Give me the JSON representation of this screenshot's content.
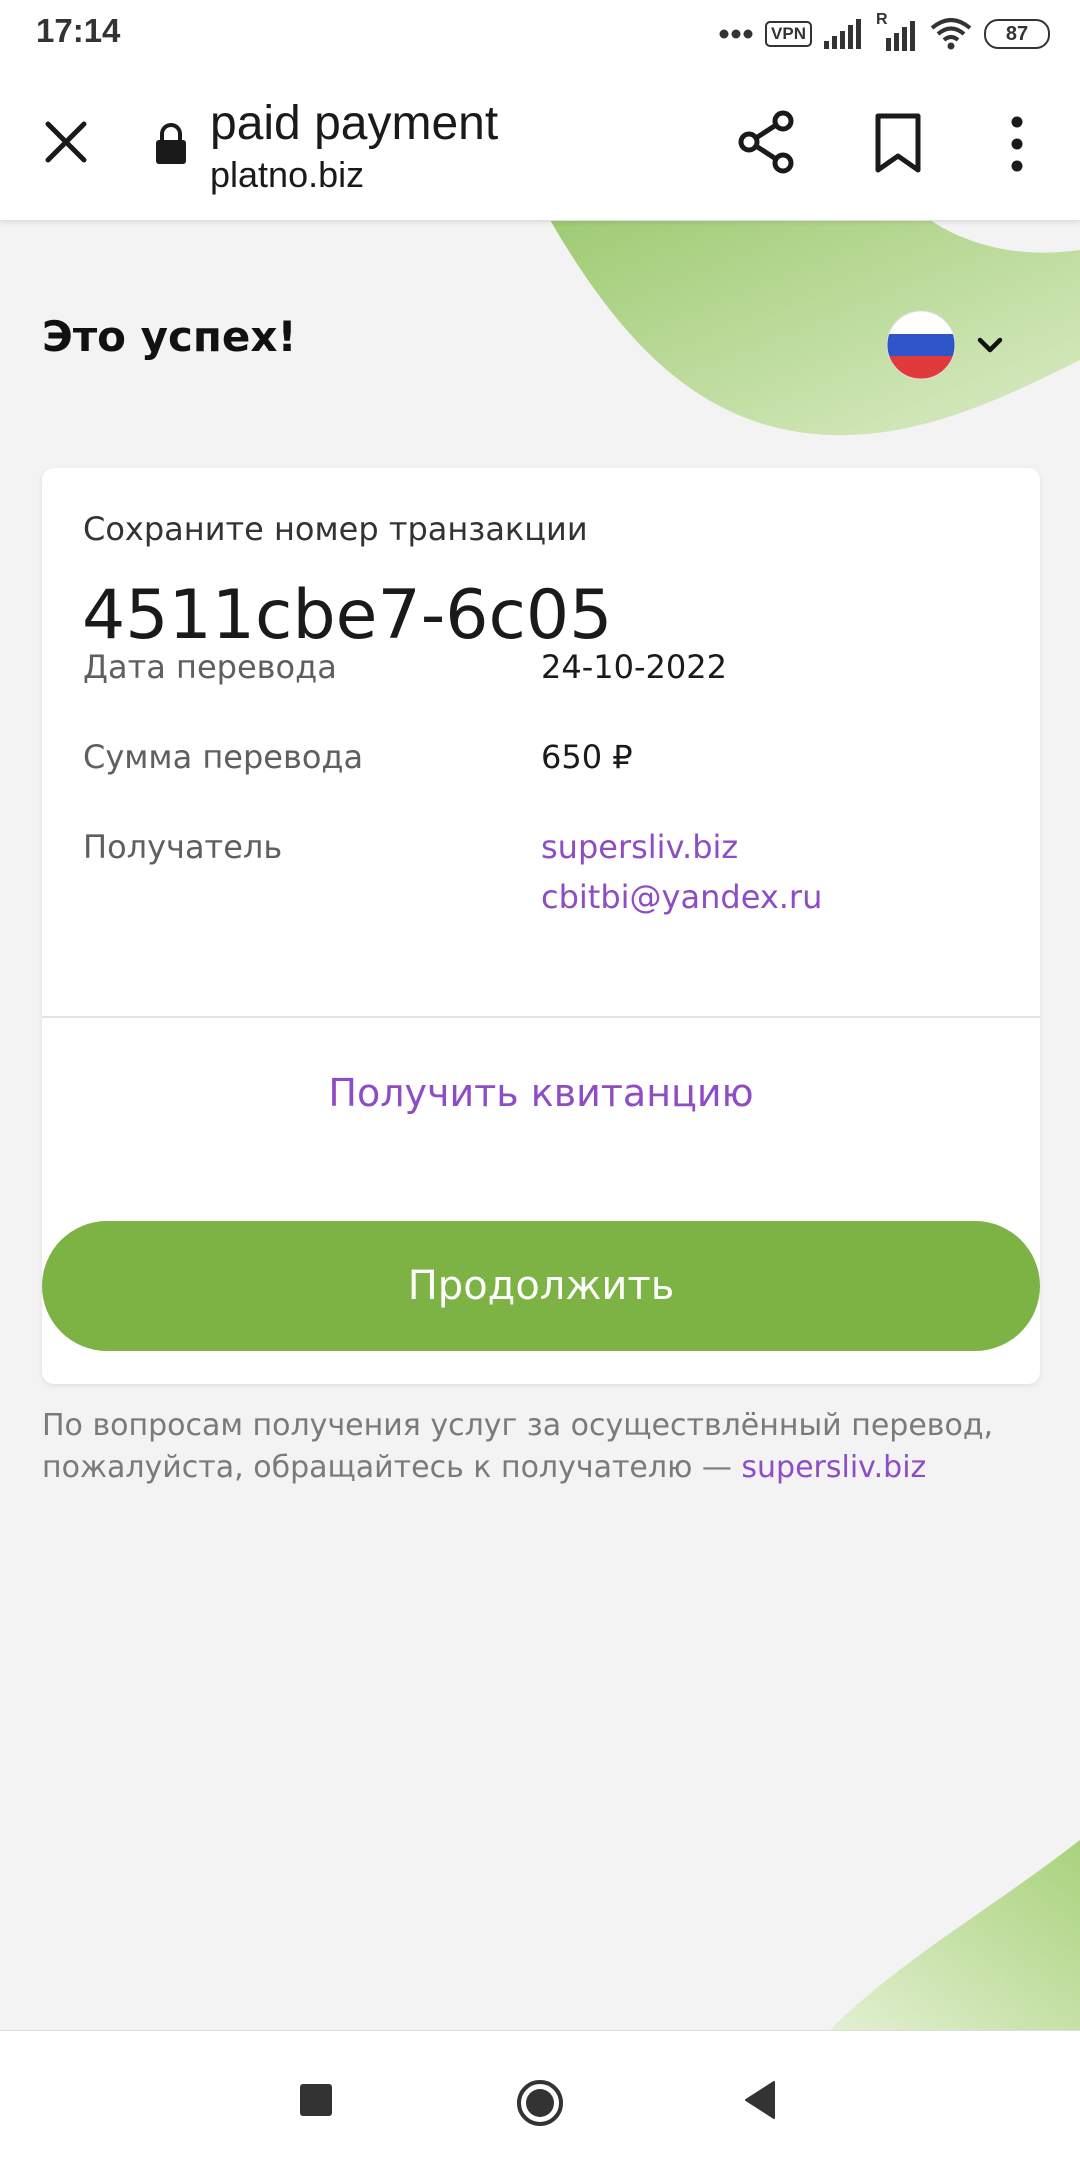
{
  "status_bar": {
    "time": "17:14",
    "vpn_label": "VPN",
    "roaming_label": "R",
    "battery_level": "87"
  },
  "browser_toolbar": {
    "page_title": "paid payment",
    "url": "platno.biz"
  },
  "page": {
    "title": "Это успех!",
    "language": {
      "flag": "russia-flag",
      "selected": "ru"
    },
    "card": {
      "save_label": "Сохраните номер транзакции",
      "transaction_number": "4511cbe7-6c05",
      "rows": [
        {
          "label": "Дата перевода",
          "value": "24-10-2022"
        },
        {
          "label": "Сумма перевода",
          "value": "650 ₽"
        },
        {
          "label": "Получатель",
          "value": "supersliv.biz",
          "value2": "cbitbi@yandex.ru"
        }
      ],
      "receipt_button": "Получить квитанцию"
    },
    "continue_button": "Продолжить",
    "footer_note": "По вопросам получения услуг за осуществлённый перевод, пожалуйста, обращайтесь к получателю —",
    "footer_link": "supersliv.biz"
  },
  "colors": {
    "accent_green": "#7db345",
    "link_purple": "#8e4dc4",
    "background": "#f3f3f3"
  }
}
